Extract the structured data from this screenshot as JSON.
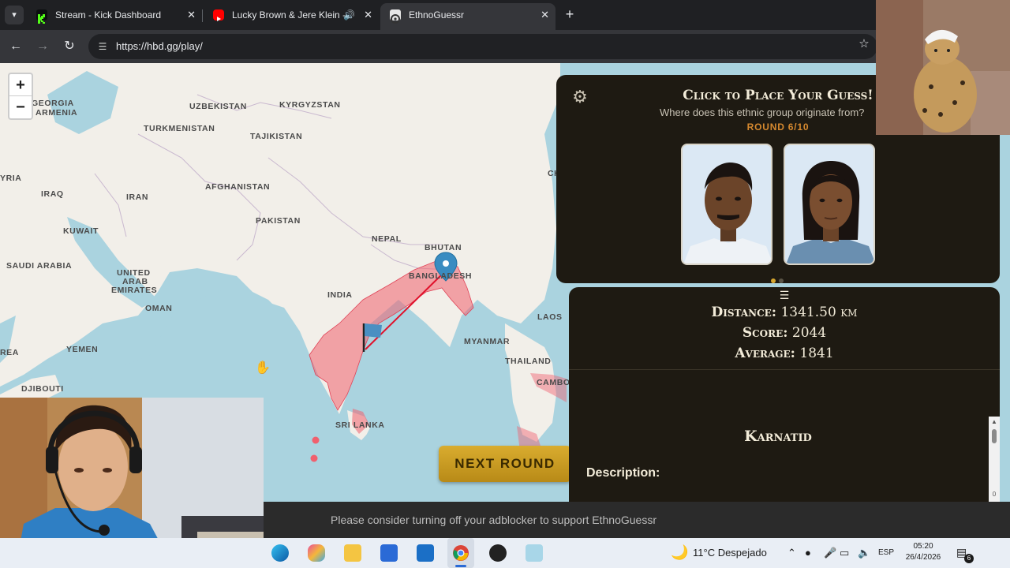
{
  "browser": {
    "tabs": [
      {
        "title": "Stream - Kick Dashboard",
        "favicon": "kick-icon",
        "color": "#53fc18"
      },
      {
        "title": "Lucky Brown & Jere Klein -",
        "favicon": "youtube-icon",
        "color": "#ff0000",
        "audio": true
      },
      {
        "title": "EthnoGuessr",
        "favicon": "ethnoguessr-icon",
        "color": "#cccccc",
        "active": true
      }
    ],
    "new_tab_label": "+",
    "url": "https://hbd.gg/play/"
  },
  "map": {
    "labels": [
      {
        "key": "georgia",
        "text": "GEORGIA"
      },
      {
        "key": "armenia",
        "text": "ARMENIA"
      },
      {
        "key": "uzbekistan",
        "text": "UZBEKISTAN"
      },
      {
        "key": "kyrgyzstan",
        "text": "KYRGYZSTAN"
      },
      {
        "key": "turkmenistan",
        "text": "TURKMENISTAN"
      },
      {
        "key": "tajikistan",
        "text": "TAJIKISTAN"
      },
      {
        "key": "syria",
        "text": "YRIA"
      },
      {
        "key": "iraq",
        "text": "IRAQ"
      },
      {
        "key": "iran",
        "text": "IRAN"
      },
      {
        "key": "afghanistan",
        "text": "AFGHANISTAN"
      },
      {
        "key": "kuwait",
        "text": "KUWAIT"
      },
      {
        "key": "pakistan",
        "text": "PAKISTAN"
      },
      {
        "key": "nepal",
        "text": "NEPAL"
      },
      {
        "key": "bhutan",
        "text": "BHUTAN"
      },
      {
        "key": "saudi",
        "text": "SAUDI ARABIA"
      },
      {
        "key": "uae1",
        "text": "UNITED"
      },
      {
        "key": "uae2",
        "text": "ARAB"
      },
      {
        "key": "uae3",
        "text": "EMIRATES"
      },
      {
        "key": "bangladesh",
        "text": "BANGLADESH"
      },
      {
        "key": "oman",
        "text": "OMAN"
      },
      {
        "key": "india",
        "text": "INDIA"
      },
      {
        "key": "laos",
        "text": "LAOS"
      },
      {
        "key": "myanmar",
        "text": "MYANMAR"
      },
      {
        "key": "eritrea",
        "text": "REA"
      },
      {
        "key": "yemen",
        "text": "YEMEN"
      },
      {
        "key": "thailand",
        "text": "THAILAND"
      },
      {
        "key": "cambodia",
        "text": "CAMBO"
      },
      {
        "key": "djibouti",
        "text": "DJIBOUTI"
      },
      {
        "key": "srilanka",
        "text": "SRI LANKA"
      },
      {
        "key": "china",
        "text": "CH"
      }
    ],
    "zoom_in": "+",
    "zoom_out": "−",
    "next_round_label": "NEXT ROUND",
    "guess_line_color": "#e0112b",
    "region_color": "#f0606e"
  },
  "question": {
    "title": "Click to Place Your Guess!",
    "subtitle": "Where does this ethnic group originate from?",
    "round": "ROUND 6/10",
    "active_dot_color": "#d6a62f"
  },
  "results": {
    "distance_label": "Distance:",
    "distance_value": "1341.50 km",
    "score_label": "Score:",
    "score_value": "2044",
    "average_label": "Average:",
    "average_value": "1841",
    "ethnic_group": "Karnatid",
    "description_label": "Description:",
    "scroll_value": "0"
  },
  "adbar": {
    "message": "Please consider turning off your adblocker to support EthnoGuessr"
  },
  "taskbar": {
    "weather": "11°C  Despejado",
    "language": "ESP",
    "time": "05:20",
    "date": "26/4/2026",
    "notifications": "6"
  }
}
